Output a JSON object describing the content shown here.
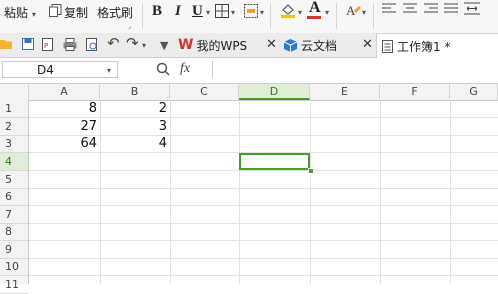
{
  "ribbon": {
    "paste_label": "粘贴",
    "copy_label": "复制",
    "format_painter_label": "格式刷",
    "bold": "B",
    "italic": "I",
    "underline": "U",
    "font_color_letter": "A",
    "font_color": "#d9342b",
    "fill_color": "#f5c400"
  },
  "tabs": [
    {
      "label": "我的WPS",
      "icon": "wps-logo-icon",
      "color": "#d9342b"
    },
    {
      "label": "云文档",
      "icon": "cloud-cube-icon",
      "color": "#2a7ad5"
    },
    {
      "label": "工作簿1 *",
      "icon": "sheet-doc-icon",
      "active": true
    }
  ],
  "formula_bar": {
    "name_box": "D4",
    "fx_label": "fx",
    "value": ""
  },
  "columns": [
    "A",
    "B",
    "C",
    "D",
    "E",
    "F",
    "G"
  ],
  "selected_column": "D",
  "rows": [
    "1",
    "2",
    "3",
    "4",
    "5",
    "6",
    "7",
    "8",
    "9",
    "10",
    "11"
  ],
  "selected_row": "4",
  "cells": {
    "A1": "8",
    "B1": "2",
    "A2": "27",
    "B2": "3",
    "A3": "64",
    "B3": "4"
  },
  "accent": "#4a9a32"
}
